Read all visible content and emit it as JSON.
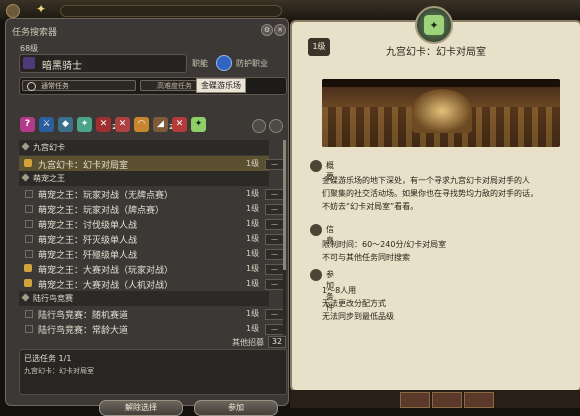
{
  "left_panel": {
    "title": "任务搜索器",
    "level": "68级",
    "job_name": "暗黑骑士",
    "role_label": "职能",
    "role_name": "防护职业",
    "filter_type": "通常任务",
    "filter_level": "高难度任务",
    "tooltip": "金碟游乐场",
    "icon_badges": [
      "2",
      "2"
    ],
    "categories": [
      {
        "label": "九宫幻卡",
        "items": [
          {
            "name": "九宫幻卡：幻卡对局室",
            "level": "1级",
            "locked": false,
            "selected": true
          }
        ]
      },
      {
        "label": "萌宠之王",
        "items": [
          {
            "name": "萌宠之王：玩家对战（无牌点赛）",
            "level": "1级",
            "locked": false
          },
          {
            "name": "萌宠之王：玩家对战（牌点赛）",
            "level": "1级",
            "locked": false
          },
          {
            "name": "萌宠之王：讨伐级单人战",
            "level": "1级",
            "locked": false
          },
          {
            "name": "萌宠之王：歼灭级单人战",
            "level": "1级",
            "locked": false
          },
          {
            "name": "萌宠之王：歼殛级单人战",
            "level": "1级",
            "locked": false
          },
          {
            "name": "萌宠之王：大赛对战（玩家对战）",
            "level": "1级",
            "locked": true
          },
          {
            "name": "萌宠之王：大赛对战（人机对战）",
            "level": "1级",
            "locked": true
          }
        ]
      },
      {
        "label": "陆行鸟竞赛",
        "items": [
          {
            "name": "陆行鸟竞赛：随机赛道",
            "level": "1级",
            "locked": false
          },
          {
            "name": "陆行鸟竞赛：常龄大道",
            "level": "1级",
            "locked": false
          }
        ]
      }
    ],
    "dash": "—",
    "other_label": "其他招募",
    "other_count": "32",
    "selected_count": "已选任务 1/1",
    "selected_item": "九宫幻卡：幻卡对局室",
    "clear_button": "解除选择",
    "join_button": "参加"
  },
  "right_panel": {
    "level_badge": "1级",
    "title": "九宫幻卡：幻卡对局室",
    "overview_label": "概要",
    "overview_lines": [
      "金碟游乐场的地下深处，有一个寻求九宫幻卡对局对手的人",
      "们聚集的社交活动场。如果你也在寻找势均力敌的对手的话，",
      "不妨去“幻卡对局室”看看。"
    ],
    "info_label": "信息",
    "info_lines": [
      "限制时间：60～240分/幻卡对局室",
      "不可与其他任务同时搜索"
    ],
    "cond_label": "参加条件",
    "cond_lines": [
      "1～8人用",
      "无法更改分配方式",
      "无法同步到最低品级"
    ]
  }
}
